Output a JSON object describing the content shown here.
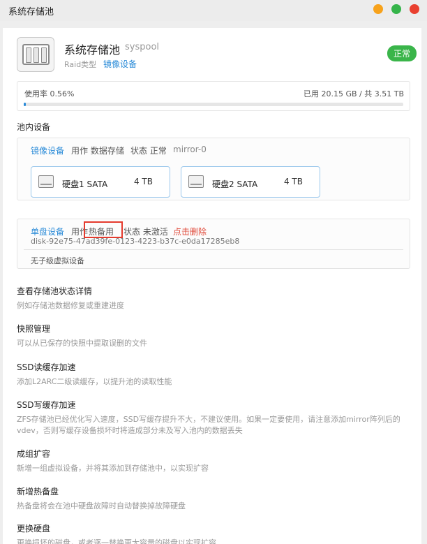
{
  "window": {
    "title": "系统存储池",
    "controls": {
      "minimize_color": "#f7a21b",
      "maximize_color": "#35b44a",
      "close_color": "#e9402f"
    }
  },
  "pool": {
    "icon": "storage-pool-icon",
    "name": "系统存储池",
    "id": "syspool",
    "raid_label": "Raid类型",
    "raid_value": "镜像设备",
    "status": "正常"
  },
  "usage": {
    "label": "使用率 0.56%",
    "percent": 0.56,
    "summary": "已用 20.15 GB / 共 3.51 TB"
  },
  "devices_title": "池内设备",
  "mirror_group": {
    "type": "镜像设备",
    "usage": "用作 数据存储",
    "status": "状态 正常",
    "name": "mirror-0",
    "disks": [
      {
        "name": "硬盘1 SATA",
        "size": "4 TB"
      },
      {
        "name": "硬盘2 SATA",
        "size": "4 TB"
      }
    ]
  },
  "single_group": {
    "type": "单盘设备",
    "usage_prefix": "用作",
    "usage_value": "热备用",
    "status": "状态 未激活",
    "delete": "点击删除",
    "disk_id": "disk-92e75-47ad39fe-0123-4223-b37c-e0da17285eb8",
    "no_child": "无子级虚拟设备"
  },
  "options": [
    {
      "title": "查看存储池状态详情",
      "desc": "例如存储池数据修复或重建进度"
    },
    {
      "title": "快照管理",
      "desc": "可以从已保存的快照中提取误删的文件"
    },
    {
      "title": "SSD读缓存加速",
      "desc": "添加L2ARC二级读缓存，以提升池的读取性能"
    },
    {
      "title": "SSD写缓存加速",
      "desc": "ZFS存储池已经优化写入速度，SSD写缓存提升不大，不建议使用。如果一定要使用，请注意添加mirror阵列后的vdev，否则写缓存设备损坏时将造成部分未及写入池内的数据丢失"
    },
    {
      "title": "成组扩容",
      "desc": "新增一组虚拟设备，并将其添加到存储池中，以实现扩容"
    },
    {
      "title": "新增热备盘",
      "desc": "热备盘将会在池中硬盘故障时自动替换掉故障硬盘"
    },
    {
      "title": "更换硬盘",
      "desc": "更换损坏的磁盘，或者逐一替换更大容量的磁盘以实现扩容"
    }
  ]
}
